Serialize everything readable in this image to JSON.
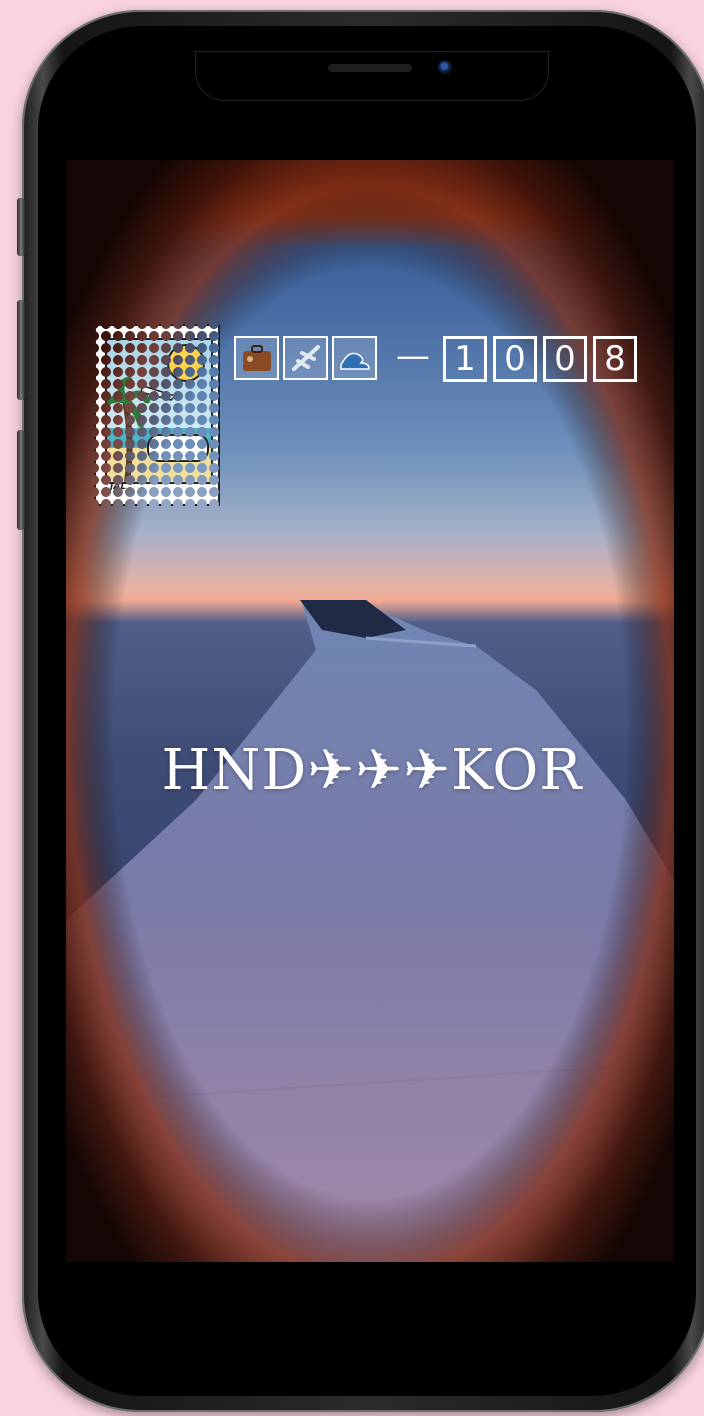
{
  "story": {
    "route": "HND✈✈✈KOR",
    "counter_digits": [
      "1",
      "0",
      "0",
      "8"
    ],
    "separator": "—",
    "emoji_icons": [
      "luggage-icon",
      "airplane-icon",
      "wave-icon"
    ],
    "stamp_label": "JAL"
  },
  "colors": {
    "background": "#f9d3e1",
    "phone_frame": "#2b2b2b",
    "text": "#ffffff"
  }
}
